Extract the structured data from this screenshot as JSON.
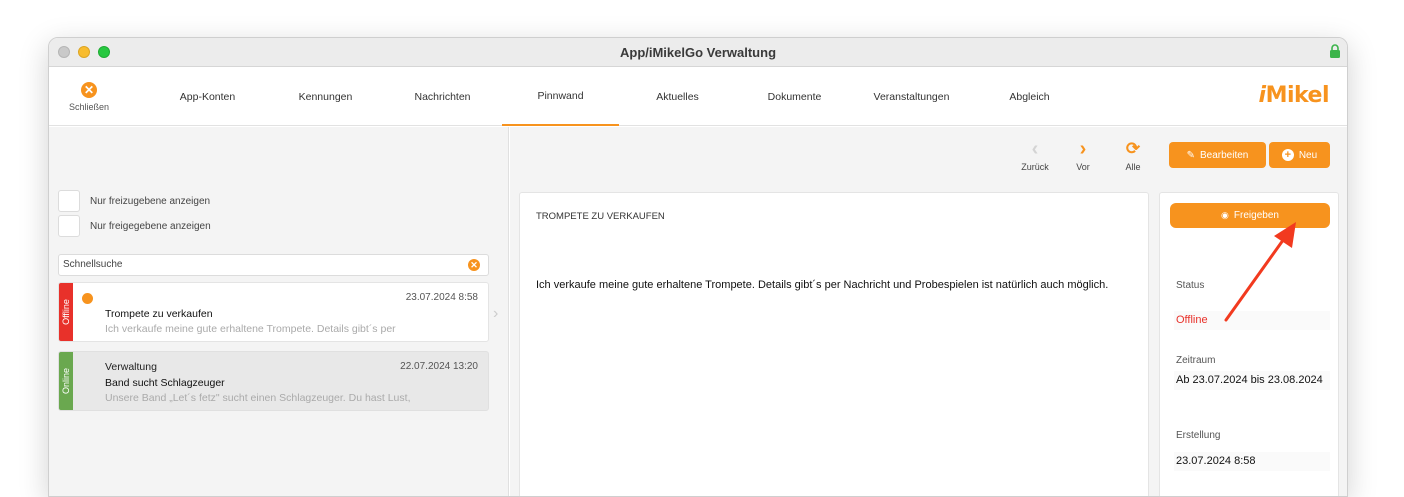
{
  "window": {
    "title": "App/iMikelGo Verwaltung"
  },
  "toolbar": {
    "close_label": "Schließen",
    "tabs": [
      "App-Konten",
      "Kennungen",
      "Nachrichten",
      "Pinnwand",
      "Aktuelles",
      "Dokumente",
      "Veranstaltungen",
      "Abgleich"
    ],
    "active_tab": "Pinnwand",
    "logo": {
      "i": "i",
      "rest": "Mikel"
    }
  },
  "filters": {
    "only_to_release": "Nur freizugebene anzeigen",
    "only_released": "Nur freigegebene anzeigen"
  },
  "search": {
    "placeholder": "Schnellsuche",
    "value": "Schnellsuche"
  },
  "list": [
    {
      "status": "Offline",
      "status_color": "#e8312a",
      "date": "23.07.2024 8:58",
      "sender": "",
      "title": "Trompete zu verkaufen",
      "preview": "Ich verkaufe meine gute erhaltene Trompete. Details gibt´s per"
    },
    {
      "status": "Online",
      "status_color": "#6aa84f",
      "date": "22.07.2024 13:20",
      "sender": "Verwaltung",
      "title": "Band sucht Schlagzeuger",
      "preview": "Unsere Band „Let´s fetz\" sucht einen Schlagzeuger. Du hast Lust,"
    }
  ],
  "nav": {
    "back": "Zurück",
    "next": "Vor",
    "all": "Alle"
  },
  "actions": {
    "edit": "Bearbeiten",
    "new": "Neu",
    "release": "Freigeben"
  },
  "detail": {
    "title": "TROMPETE ZU VERKAUFEN",
    "body": "Ich verkaufe meine gute erhaltene Trompete. Details gibt´s per Nachricht und Probespielen ist natürlich auch möglich."
  },
  "side": {
    "status_label": "Status",
    "status_value": "Offline",
    "period_label": "Zeitraum",
    "period_value": "Ab 23.07.2024 bis 23.08.2024",
    "created_label": "Erstellung",
    "created_value": "23.07.2024 8:58"
  },
  "colors": {
    "accent": "#f7931e",
    "offline": "#e8312a",
    "online": "#6aa84f",
    "annotation_arrow": "#f23a1f"
  }
}
